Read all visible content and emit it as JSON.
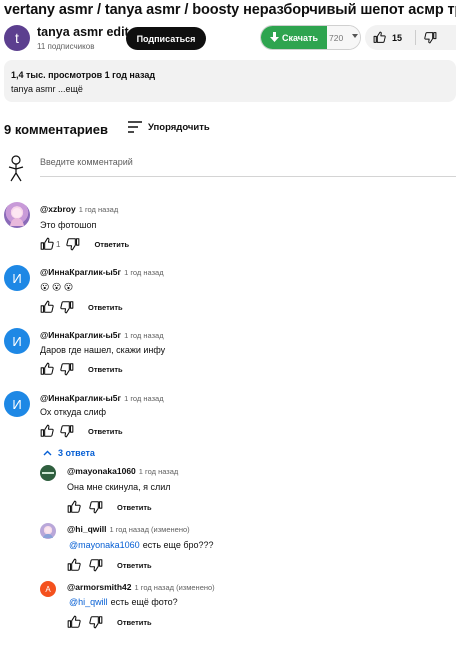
{
  "video": {
    "title": "vertany asmr / tanya asmr / boosty неразборчивый шепот асмр триггеры"
  },
  "channel": {
    "avatar_letter": "t",
    "name": "tanya asmr edit",
    "subscribers": "11 подписчиков",
    "subscribe_label": "Подписаться"
  },
  "download": {
    "label": "Скачать",
    "quality": "720"
  },
  "likes": {
    "count": "15"
  },
  "description": {
    "meta": "1,4 тыс. просмотров  1 год назад",
    "text": "tanya asmr ...ещё"
  },
  "comments_header": {
    "count_label": "9 комментариев",
    "sort_label": "Упорядочить"
  },
  "add_comment": {
    "placeholder": "Введите комментарий"
  },
  "comments": [
    {
      "author": "@xzbroy",
      "time": "1 год назад",
      "text": "Это фотошоп",
      "likes": "1",
      "reply_label": "Ответить",
      "avatar": ""
    },
    {
      "author": "@ИннаКраглик-ы5г",
      "time": "1 год назад",
      "text": "😮 😮 😮",
      "likes": "",
      "reply_label": "Ответить",
      "avatar": "И"
    },
    {
      "author": "@ИннаКраглик-ы5г",
      "time": "1 год назад",
      "text": "Даров где нашел, скажи инфу",
      "likes": "",
      "reply_label": "Ответить",
      "avatar": "И"
    },
    {
      "author": "@ИннаКраглик-ы5г",
      "time": "1 год назад",
      "text": "Ох откуда слиф",
      "likes": "",
      "reply_label": "Ответить",
      "avatar": "И"
    }
  ],
  "replies_toggle": "3 ответа",
  "replies": [
    {
      "author": "@mayonaka1060",
      "time": "1 год назад",
      "mention": "",
      "text": "Она мне скинула, я слил",
      "reply_label": "Ответить",
      "avatar": ""
    },
    {
      "author": "@hi_qwill",
      "time": "1 год назад (изменено)",
      "mention": "@mayonaka1060",
      "text": "есть еще бро???",
      "reply_label": "Ответить",
      "avatar": ""
    },
    {
      "author": "@armorsmith42",
      "time": "1 год назад (изменено)",
      "mention": "@hi_qwill",
      "text": "есть ещё фото?",
      "reply_label": "Ответить",
      "avatar": "A"
    }
  ],
  "colors": {
    "download_green": "#2ea44f",
    "link_blue": "#065fd4",
    "avatar_blue": "#1e88e5",
    "reply_avatar_orange": "#f4511e"
  }
}
